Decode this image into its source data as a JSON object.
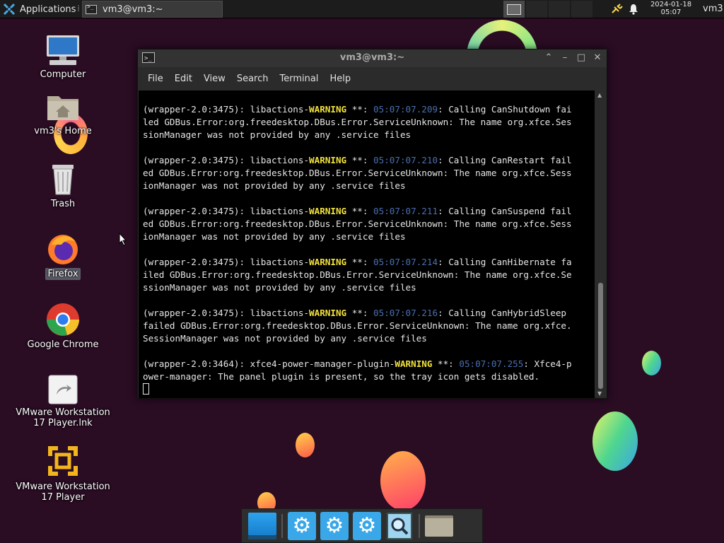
{
  "top_panel": {
    "applications_label": "Applications",
    "task_window_title": "vm3@vm3:~",
    "clock_date": "2024-01-18",
    "clock_time": "05:07",
    "user": "vm3"
  },
  "desktop_icons": [
    {
      "label": "Computer"
    },
    {
      "label": "vm3's Home"
    },
    {
      "label": "Trash"
    },
    {
      "label": "Firefox"
    },
    {
      "label": "Google Chrome"
    },
    {
      "label": "VMware Workstation 17 Player.lnk"
    },
    {
      "label": "VMware Workstation 17 Player"
    }
  ],
  "terminal": {
    "title": "vm3@vm3:~",
    "menu": [
      "File",
      "Edit",
      "View",
      "Search",
      "Terminal",
      "Help"
    ],
    "blocks": [
      {
        "prefix": "(wrapper-2.0:3475): libactions-",
        "level": "WARNING",
        "sep": " **: ",
        "time": "05:07:07.209",
        "msg": ": Calling CanShutdown failed GDBus.Error:org.freedesktop.DBus.Error.ServiceUnknown: The name org.xfce.SessionManager was not provided by any .service files"
      },
      {
        "prefix": "(wrapper-2.0:3475): libactions-",
        "level": "WARNING",
        "sep": " **: ",
        "time": "05:07:07.210",
        "msg": ": Calling CanRestart failed GDBus.Error:org.freedesktop.DBus.Error.ServiceUnknown: The name org.xfce.SessionManager was not provided by any .service files"
      },
      {
        "prefix": "(wrapper-2.0:3475): libactions-",
        "level": "WARNING",
        "sep": " **: ",
        "time": "05:07:07.211",
        "msg": ": Calling CanSuspend failed GDBus.Error:org.freedesktop.DBus.Error.ServiceUnknown: The name org.xfce.SessionManager was not provided by any .service files"
      },
      {
        "prefix": "(wrapper-2.0:3475): libactions-",
        "level": "WARNING",
        "sep": " **: ",
        "time": "05:07:07.214",
        "msg": ": Calling CanHibernate failed GDBus.Error:org.freedesktop.DBus.Error.ServiceUnknown: The name org.xfce.SessionManager was not provided by any .service files"
      },
      {
        "prefix": "(wrapper-2.0:3475): libactions-",
        "level": "WARNING",
        "sep": " **: ",
        "time": "05:07:07.216",
        "msg": ": Calling CanHybridSleep failed GDBus.Error:org.freedesktop.DBus.Error.ServiceUnknown: The name org.xfce.SessionManager was not provided by any .service files"
      },
      {
        "prefix": "(wrapper-2.0:3464): xfce4-power-manager-plugin-",
        "level": "WARNING",
        "sep": " **: ",
        "time": "05:07:07.255",
        "msg": ": Xfce4-power-manager: The panel plugin is present, so the tray icon gets disabled."
      }
    ]
  },
  "dock": {
    "items": [
      "show-desktop",
      "settings",
      "settings",
      "settings",
      "app-finder",
      "file-manager"
    ]
  }
}
